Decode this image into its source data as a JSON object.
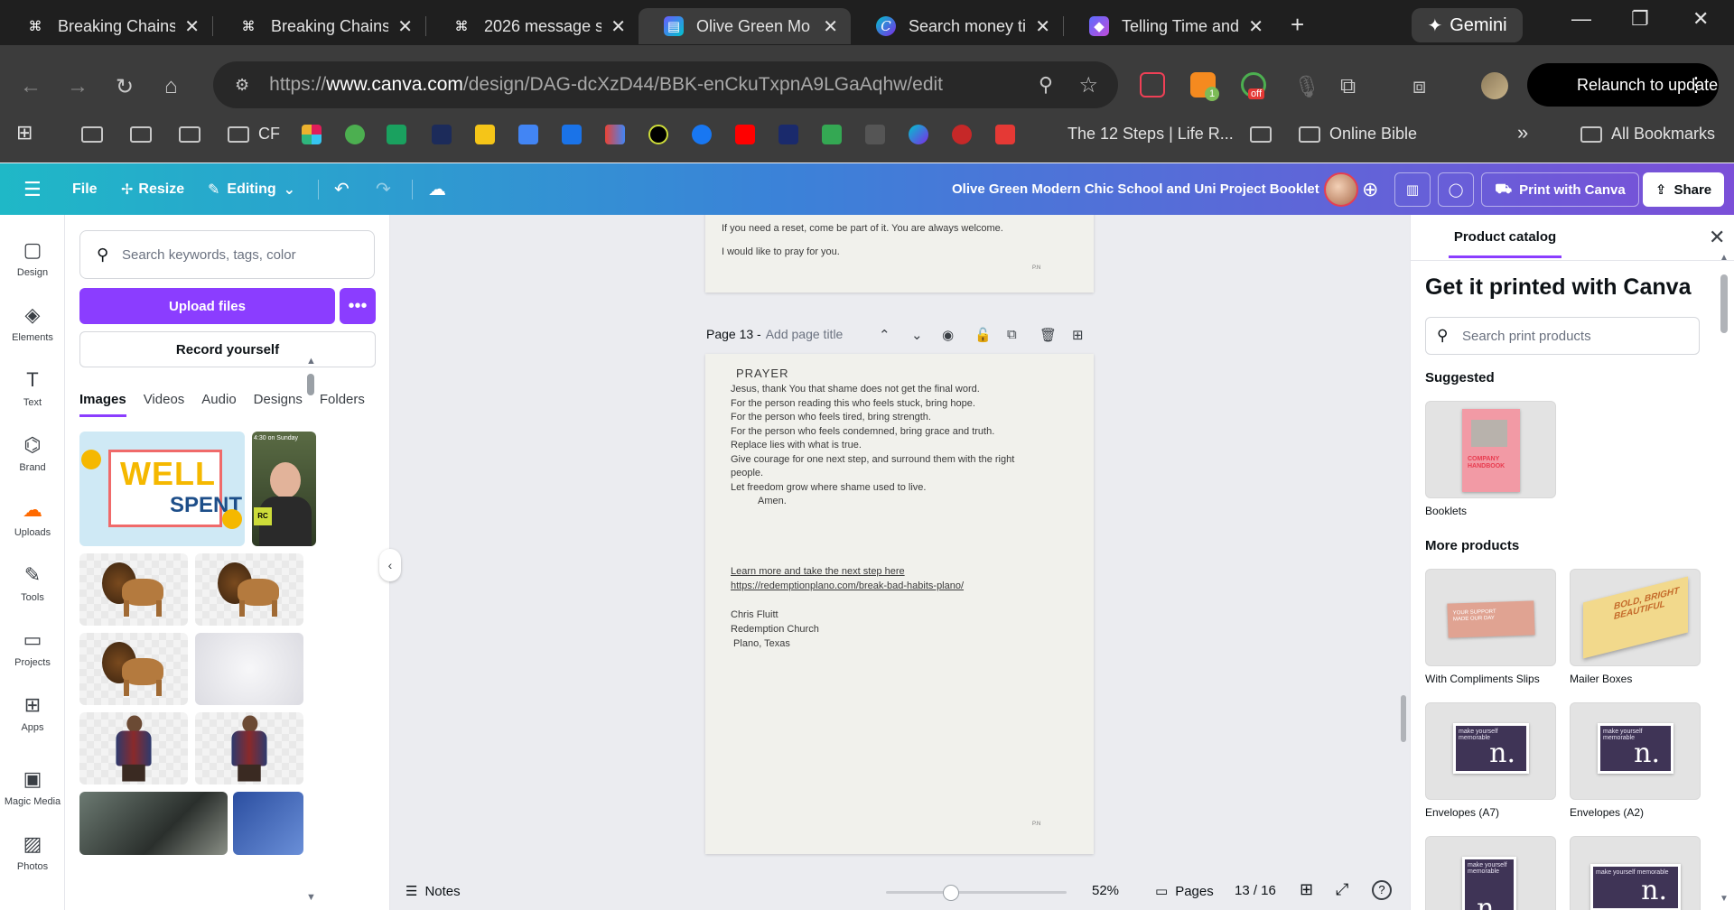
{
  "browser": {
    "tabs": [
      {
        "title": "Breaking Chains",
        "icon": "chatgpt-icon",
        "active": false
      },
      {
        "title": "Breaking Chains",
        "icon": "chatgpt-icon",
        "active": false
      },
      {
        "title": "2026 message s",
        "icon": "chatgpt-icon",
        "active": false
      },
      {
        "title": "Olive Green Mo",
        "icon": "canva-icon",
        "active": true
      },
      {
        "title": "Search money ti",
        "icon": "canva-icon",
        "active": false
      },
      {
        "title": "Telling Time and",
        "icon": "copilot-icon",
        "active": false
      }
    ],
    "new_tab_label": "+",
    "gemini_label": "Gemini",
    "url_prefix": "https://",
    "url_domain": "www.canva.com",
    "url_path": "/design/DAG-dcXzD44/BBK-enCkuTxpnA9LGaAqhw/edit",
    "relaunch_label": "Relaunch to update",
    "ext_badge_1": "1",
    "ext_badge_off": "off"
  },
  "bookmarks": {
    "cf_label": "CF",
    "steps_label": "The 12 Steps | Life R...",
    "online_bible_label": "Online Bible",
    "all_bookmarks_label": "All Bookmarks",
    "overflow": "»"
  },
  "canva_header": {
    "file": "File",
    "resize": "Resize",
    "editing": "Editing",
    "design_title": "Olive Green Modern Chic School and Uni Project Booklet",
    "print_label": "Print with Canva",
    "share_label": "Share"
  },
  "rail": [
    {
      "label": "Design",
      "icon": "design-icon"
    },
    {
      "label": "Elements",
      "icon": "elements-icon"
    },
    {
      "label": "Text",
      "icon": "text-icon"
    },
    {
      "label": "Brand",
      "icon": "brand-icon"
    },
    {
      "label": "Uploads",
      "icon": "uploads-icon"
    },
    {
      "label": "Tools",
      "icon": "tools-icon"
    },
    {
      "label": "Projects",
      "icon": "projects-icon"
    },
    {
      "label": "Apps",
      "icon": "apps-icon"
    },
    {
      "label": "Magic Media",
      "icon": "magic-media-icon"
    },
    {
      "label": "Photos",
      "icon": "photos-icon"
    }
  ],
  "panel": {
    "search_placeholder": "Search keywords, tags, color",
    "upload_label": "Upload files",
    "more_label": "•••",
    "record_label": "Record yourself",
    "tabs": [
      "Images",
      "Videos",
      "Audio",
      "Designs",
      "Folders"
    ],
    "well_line1": "WELL",
    "well_line2": "SPENT",
    "photo_caption": "4:30 on Sunday",
    "photo_badge": "RC"
  },
  "canvas": {
    "prev_page_lines": [
      "If you need a reset, come be part of it. You are always welcome.",
      "I would like to pray for you."
    ],
    "page_label": "Page 13 -",
    "page_title_placeholder": "Add page title",
    "heading": "PRAYER",
    "prayer_lines": [
      "Jesus, thank You that shame does not get the final word.",
      "For the person reading this who feels stuck, bring hope.",
      "For the person who feels tired, bring strength.",
      "For the person who feels condemned, bring grace and truth.",
      "Replace lies with what is true.",
      "Give courage for one next step, and surround them with the right",
      "people.",
      "Let freedom grow where shame used to live."
    ],
    "amen": "Amen.",
    "link_text": "Learn more and take the next step here",
    "link_url": "https://redemptionplano.com/break-bad-habits-plano/",
    "signature": [
      "Chris Fluitt",
      "Redemption Church",
      " Plano, Texas"
    ],
    "page_number_mark": "P.N"
  },
  "bottom": {
    "notes_label": "Notes",
    "zoom": "52%",
    "zoom_fraction": 0.36,
    "pages_label": "Pages",
    "page_count": "13 / 16",
    "help": "?"
  },
  "right_panel": {
    "tab": "Product catalog",
    "title": "Get it printed with Canva",
    "search_placeholder": "Search print products",
    "suggested_heading": "Suggested",
    "more_heading": "More products",
    "products": {
      "booklets": "Booklets",
      "compliments": "With Compliments Slips",
      "mailer": "Mailer Boxes",
      "env_a7": "Envelopes (A7)",
      "env_a2": "Envelopes (A2)"
    },
    "booklet_cover_text": "COMPANY HANDBOOK",
    "slip_text": "YOUR SUPPORT MADE OUR DAY",
    "mailer_text": "BOLD, BRIGHT BEAUTIFUL",
    "envelope_text": "make yourself memorable",
    "envelope_mark": "n."
  },
  "colors": {
    "canva_purple": "#8b3dff",
    "header_start": "#1fb8c7",
    "header_end": "#7b4fd8"
  }
}
